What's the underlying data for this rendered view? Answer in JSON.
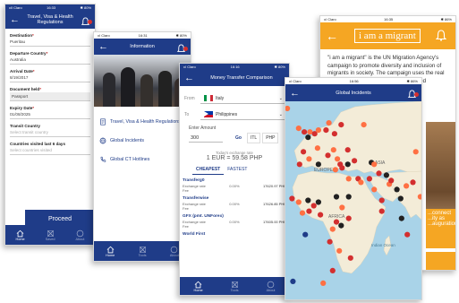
{
  "colors": {
    "primary": "#1f3c88",
    "accent": "#f5a623",
    "alert": "#d32f2f"
  },
  "status": {
    "p1": {
      "carrier": "ııll Claro",
      "time": "16:33",
      "battery": "✱ 80%"
    },
    "p2": {
      "carrier": "ııl Claro",
      "time": "16:31",
      "battery": "✱ 80%"
    },
    "p3": {
      "carrier": "ııl Claro",
      "time": "16:16",
      "battery": "✱ 80%"
    },
    "p4": {
      "carrier": "ııl Claro",
      "time": "16:56",
      "battery": "✱ 86%"
    },
    "p5": {
      "carrier": "ııl Claro",
      "time": "16:35",
      "battery": "✱ 86%"
    }
  },
  "phone1": {
    "title": "Travel, Visa & Health Regulations",
    "fields": [
      {
        "label": "Destination",
        "value": "Pueritau",
        "required": true
      },
      {
        "label": "Departure Country",
        "value": "Australia",
        "required": true
      },
      {
        "label": "Arrival Date",
        "value": "8/19/2017",
        "required": true
      },
      {
        "label": "Document held",
        "value": "Passport",
        "required": true
      },
      {
        "label": "Expiry Date",
        "value": "01/08/2025",
        "required": true
      },
      {
        "label": "Transit Country",
        "value": "Select transit country",
        "required": false
      },
      {
        "label": "Countries visited last 6 days",
        "value": "Select countries visited",
        "required": false
      }
    ],
    "proceed": "Proceed",
    "tabs": [
      "Home",
      "Saved",
      "About"
    ]
  },
  "phone2": {
    "title": "Information",
    "menu": [
      "Travel, Visa & Health Regulations",
      "Global Incidents",
      "Global CT Hotlines"
    ],
    "tabs": [
      "Home",
      "Tools",
      "About"
    ]
  },
  "phone3": {
    "title": "Money Transfer Comparison",
    "from_label": "From",
    "from_value": "Italy",
    "to_label": "To",
    "to_value": "Philippines",
    "amount_label": "Enter Amount",
    "amount_value": "300",
    "currencies": [
      "Go",
      "ITL",
      "PHP"
    ],
    "rate_caption": "Today's exchange rate",
    "rate_value": "1 EUR = 59.58 PHP",
    "tabs_sort": [
      "CHEAPEST",
      "FASTEST"
    ],
    "providers": [
      {
        "name": "Transferg0",
        "rate": "Exchange rate",
        "fee": "0.00%",
        "amount": "17620.97 PHP",
        "sub": "Fee"
      },
      {
        "name": "Transferwise",
        "rate": "Exchange rate",
        "fee": "0.00%",
        "amount": "17626.85 PHP",
        "sub": "Fee"
      },
      {
        "name": "GFX (pmt. UNForex)",
        "rate": "Exchange rate",
        "fee": "0.00%",
        "amount": "17605.00 PHP",
        "sub": "Fee"
      },
      {
        "name": "World First",
        "rate": "",
        "fee": "",
        "amount": "",
        "sub": ""
      }
    ],
    "tabs": [
      "Home",
      "Tools",
      "About"
    ]
  },
  "phone4": {
    "title": "Global Incidents",
    "labels": {
      "europe": "EUROPE",
      "asia": "ASIA",
      "africa": "AFRICA",
      "indian_ocean": "Indian Ocean"
    },
    "incidents": [
      {
        "lon": -8,
        "lat": 53,
        "c": "#ff7043"
      },
      {
        "lon": -2,
        "lat": 51,
        "c": "#d32f2f"
      },
      {
        "lon": 2,
        "lat": 48,
        "c": "#212121"
      },
      {
        "lon": 4,
        "lat": 51,
        "c": "#ff7043"
      },
      {
        "lon": 9,
        "lat": 50,
        "c": "#d32f2f"
      },
      {
        "lon": 13,
        "lat": 52,
        "c": "#ff7043"
      },
      {
        "lon": 21,
        "lat": 52,
        "c": "#d32f2f"
      },
      {
        "lon": 24,
        "lat": 56,
        "c": "#ff7043"
      },
      {
        "lon": 30,
        "lat": 50,
        "c": "#d32f2f"
      },
      {
        "lon": 37,
        "lat": 55,
        "c": "#d32f2f"
      },
      {
        "lon": 12,
        "lat": 42,
        "c": "#ff7043"
      },
      {
        "lon": -3,
        "lat": 40,
        "c": "#d32f2f"
      },
      {
        "lon": 23,
        "lat": 38,
        "c": "#d32f2f"
      },
      {
        "lon": 29,
        "lat": 41,
        "c": "#ff7043"
      },
      {
        "lon": 33,
        "lat": 36,
        "c": "#ff7043"
      },
      {
        "lon": 36,
        "lat": 33,
        "c": "#d32f2f"
      },
      {
        "lon": 44,
        "lat": 33,
        "c": "#212121"
      },
      {
        "lon": 38,
        "lat": 31,
        "c": "#d32f2f"
      },
      {
        "lon": 51,
        "lat": 35,
        "c": "#d32f2f"
      },
      {
        "lon": 45,
        "lat": 25,
        "c": "#ff7043"
      },
      {
        "lon": 31,
        "lat": 30,
        "c": "#ff7043"
      },
      {
        "lon": 13,
        "lat": 33,
        "c": "#212121"
      },
      {
        "lon": 3,
        "lat": 36,
        "c": "#ff7043"
      },
      {
        "lon": -7,
        "lat": 33,
        "c": "#d32f2f"
      },
      {
        "lon": 45,
        "lat": 15,
        "c": "#212121"
      },
      {
        "lon": -15,
        "lat": 14,
        "c": "#d32f2f"
      },
      {
        "lon": -8,
        "lat": 12,
        "c": "#ff7043"
      },
      {
        "lon": 2,
        "lat": 13,
        "c": "#212121"
      },
      {
        "lon": 8,
        "lat": 10,
        "c": "#d32f2f"
      },
      {
        "lon": 13,
        "lat": 12,
        "c": "#212121"
      },
      {
        "lon": 3,
        "lat": 7,
        "c": "#d32f2f"
      },
      {
        "lon": -4,
        "lat": 6,
        "c": "#ff7043"
      },
      {
        "lon": 15,
        "lat": 5,
        "c": "#d32f2f"
      },
      {
        "lon": 32,
        "lat": 15,
        "c": "#212121"
      },
      {
        "lon": 38,
        "lat": 9,
        "c": "#ff7043"
      },
      {
        "lon": 32,
        "lat": 1,
        "c": "#d32f2f"
      },
      {
        "lon": 37,
        "lat": -1,
        "c": "#212121"
      },
      {
        "lon": 45,
        "lat": 3,
        "c": "#d32f2f"
      },
      {
        "lon": 28,
        "lat": -3,
        "c": "#ff7043"
      },
      {
        "lon": 25,
        "lat": -10,
        "c": "#d32f2f"
      },
      {
        "lon": 35,
        "lat": -15,
        "c": "#ff7043"
      },
      {
        "lon": 28,
        "lat": -26,
        "c": "#d32f2f"
      },
      {
        "lon": 18,
        "lat": -33,
        "c": "#ff7043"
      },
      {
        "lon": 47,
        "lat": -19,
        "c": "#d32f2f"
      },
      {
        "lon": 69,
        "lat": 34,
        "c": "#212121"
      },
      {
        "lon": 67,
        "lat": 25,
        "c": "#d32f2f"
      },
      {
        "lon": 72,
        "lat": 33,
        "c": "#ff7043"
      },
      {
        "lon": 77,
        "lat": 28,
        "c": "#d32f2f"
      },
      {
        "lon": 72,
        "lat": 19,
        "c": "#ff7043"
      },
      {
        "lon": 80,
        "lat": 13,
        "c": "#d32f2f"
      },
      {
        "lon": 88,
        "lat": 22,
        "c": "#ff7043"
      },
      {
        "lon": 85,
        "lat": 27,
        "c": "#212121"
      },
      {
        "lon": 90,
        "lat": 24,
        "c": "#d32f2f"
      },
      {
        "lon": 96,
        "lat": 19,
        "c": "#212121"
      },
      {
        "lon": 100,
        "lat": 14,
        "c": "#212121"
      },
      {
        "lon": 106,
        "lat": 21,
        "c": "#ff7043"
      },
      {
        "lon": 101,
        "lat": 3,
        "c": "#212121"
      },
      {
        "lon": 107,
        "lat": -6,
        "c": "#d32f2f"
      },
      {
        "lon": 121,
        "lat": 15,
        "c": "#ff7043"
      },
      {
        "lon": 116,
        "lat": 40,
        "c": "#ff7043"
      },
      {
        "lon": 113,
        "lat": 23,
        "c": "#d32f2f"
      },
      {
        "lon": 55,
        "lat": 25,
        "c": "#d32f2f"
      },
      {
        "lon": 58,
        "lat": 23,
        "c": "#ff7043"
      },
      {
        "lon": 61,
        "lat": 55,
        "c": "#ff7043"
      },
      {
        "lon": 44,
        "lat": 41,
        "c": "#d32f2f"
      },
      {
        "lon": -1,
        "lat": -6,
        "c": "#1f3c88"
      },
      {
        "lon": -14,
        "lat": -32,
        "c": "#1f3c88"
      },
      {
        "lon": -20,
        "lat": 64,
        "c": "#ff7043"
      },
      {
        "lon": 80,
        "lat": 7,
        "c": "#d32f2f"
      }
    ]
  },
  "phone5": {
    "logo": "i am a migrant",
    "text": "\"i am a migrant\" is the UN Migration Agency's campaign to promote diversity and inclusion of migrants in society. The campaign uses the real stories of migrants and people with lived experience of migration to encourage.",
    "side_text": "...connect ...ity as ...auguration"
  }
}
